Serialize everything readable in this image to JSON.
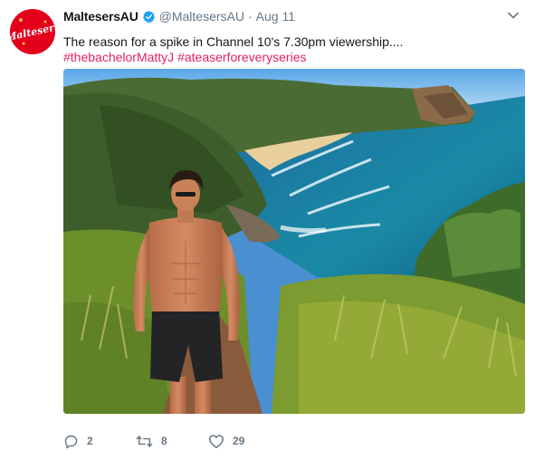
{
  "tweet": {
    "display_name": "MaltesersAU",
    "handle": "@MaltesersAU",
    "separator": "·",
    "date": "Aug 11",
    "text": "The reason for a spike in Channel 10's 7.30pm viewership....",
    "hashtags": [
      "#thebachelorMattyJ",
      "#ateaserforeveryseries"
    ],
    "avatar_logo_text": "Maltesers"
  },
  "actions": {
    "replies": "2",
    "retweets": "8",
    "likes": "29"
  },
  "icons": {
    "verified": "verified-badge-icon",
    "chevron": "chevron-down-icon",
    "reply": "reply-icon",
    "retweet": "retweet-icon",
    "like": "heart-icon"
  },
  "colors": {
    "brand_red": "#e3001b",
    "hashtag": "#e0245e",
    "verified": "#1da1f2",
    "muted": "#657786"
  }
}
